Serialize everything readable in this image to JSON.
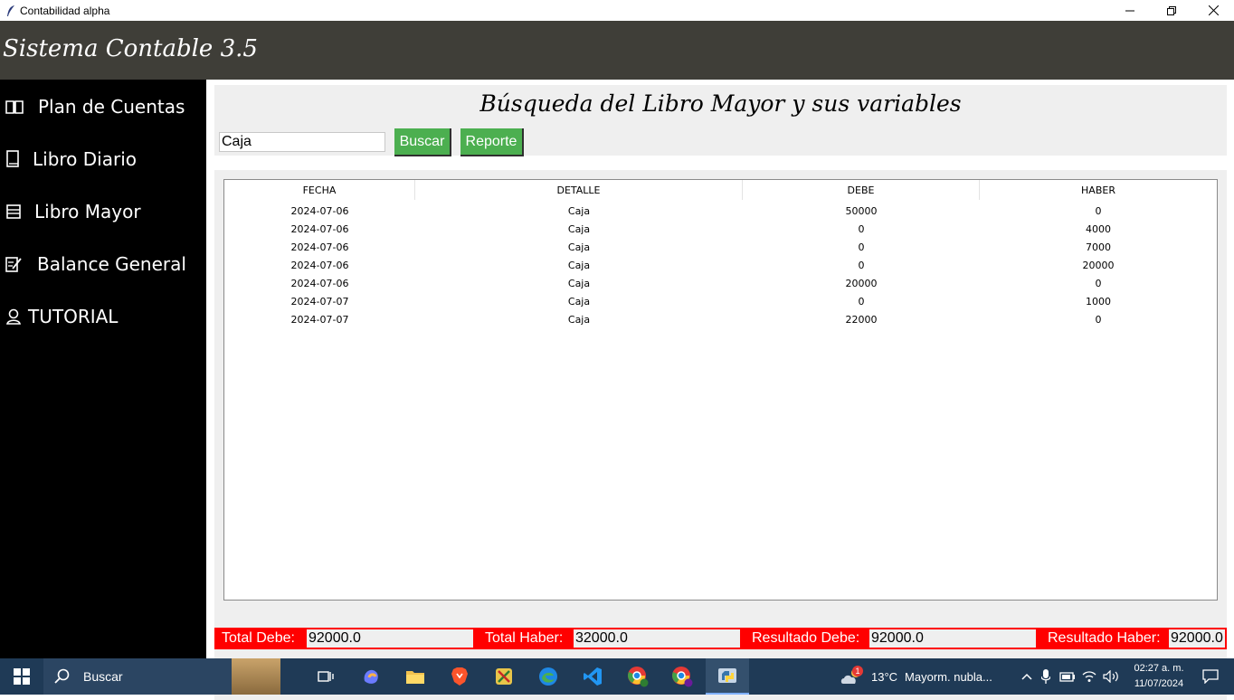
{
  "window": {
    "title": "Contabilidad alpha"
  },
  "header": {
    "brand": "Sistema Contable 3.5"
  },
  "sidebar": {
    "items": [
      {
        "label": "Plan de Cuentas",
        "icon": "book-open-icon"
      },
      {
        "label": "Libro Diario",
        "icon": "book-icon"
      },
      {
        "label": "Libro Mayor",
        "icon": "ledger-icon"
      },
      {
        "label": "Balance General",
        "icon": "edit-note-icon"
      },
      {
        "label": "TUTORIAL",
        "icon": "person-icon"
      }
    ]
  },
  "search": {
    "title": "Búsqueda del Libro Mayor y sus variables",
    "value": "Caja",
    "search_button": "Buscar",
    "report_button": "Reporte"
  },
  "table": {
    "columns": [
      "FECHA",
      "DETALLE",
      "DEBE",
      "HABER"
    ],
    "rows": [
      [
        "2024-07-06",
        "Caja",
        "50000",
        "0"
      ],
      [
        "2024-07-06",
        "Caja",
        "0",
        "4000"
      ],
      [
        "2024-07-06",
        "Caja",
        "0",
        "7000"
      ],
      [
        "2024-07-06",
        "Caja",
        "0",
        "20000"
      ],
      [
        "2024-07-06",
        "Caja",
        "20000",
        "0"
      ],
      [
        "2024-07-07",
        "Caja",
        "0",
        "1000"
      ],
      [
        "2024-07-07",
        "Caja",
        "22000",
        "0"
      ]
    ]
  },
  "totals": {
    "total_debe_label": "Total Debe:",
    "total_debe": "92000.0",
    "total_haber_label": "Total Haber:",
    "total_haber": "32000.0",
    "resultado_debe_label": "Resultado Debe:",
    "resultado_debe": "92000.0",
    "resultado_haber_label": "Resultado Haber:",
    "resultado_haber": "92000.0"
  },
  "taskbar": {
    "search_placeholder": "Buscar",
    "weather_temp": "13°C",
    "weather_text": "Mayorm. nubla...",
    "weather_badge": "1",
    "time": "02:27 a. m.",
    "date": "11/07/2024"
  },
  "colors": {
    "header_bg": "#3f3e38",
    "sidebar_bg": "#000000",
    "button_green": "#4caf50",
    "totals_red": "#ff0000",
    "taskbar_bg": "#1f3a56"
  }
}
